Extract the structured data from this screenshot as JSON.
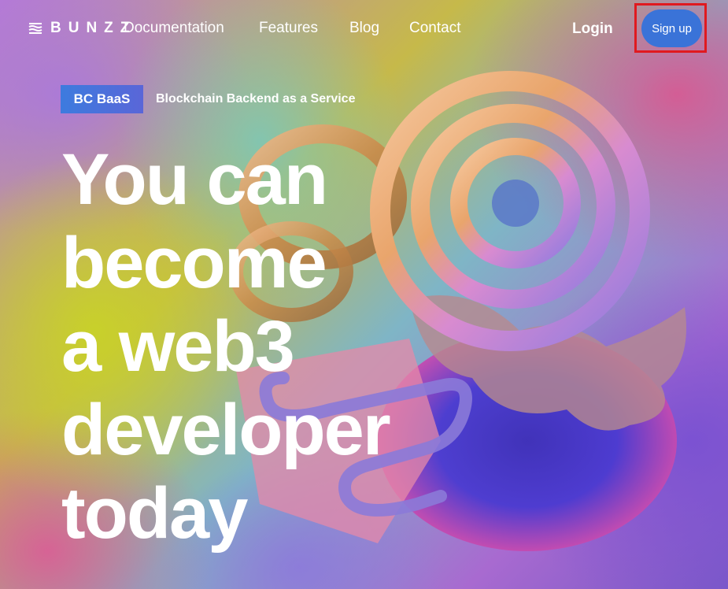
{
  "nav": {
    "logo_text": "BUNZZ",
    "logo_icon": "stacked-waves-icon",
    "links": [
      "Documentation",
      "Features",
      "Blog",
      "Contact"
    ],
    "login_label": "Login",
    "signup_label": "Sign up"
  },
  "hero": {
    "badge": "BC BaaS",
    "badge_caption": "Blockchain Backend as a Service",
    "headline_lines": [
      "You can",
      "become",
      "a web3",
      "developer",
      "today"
    ]
  },
  "colors": {
    "signup_bg": "#3a73d8",
    "badge_bg": "#4a70da",
    "highlight": "#e0191f"
  }
}
